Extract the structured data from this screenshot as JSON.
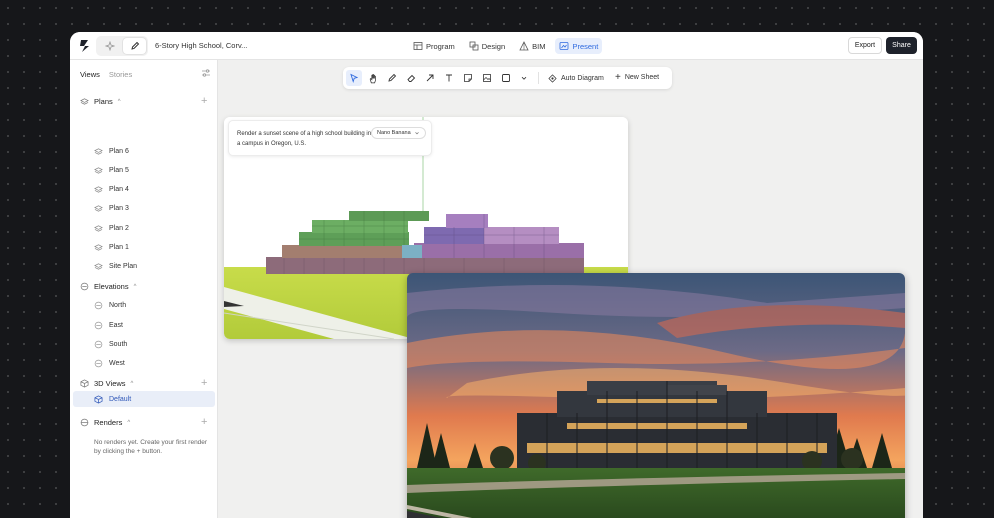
{
  "app": {
    "doc_title": "6-Story High School, Corv...",
    "nav": [
      "Program",
      "Design",
      "BIM",
      "Present"
    ],
    "active_nav": "Present",
    "export_label": "Export",
    "share_label": "Share",
    "accent": "#2f6adf"
  },
  "sidebar": {
    "tabs": [
      "Views",
      "Stories"
    ],
    "active_tab": "Views",
    "plans": {
      "label": "Plans",
      "items": [
        "Plan 6",
        "Plan 5",
        "Plan 4",
        "Plan 3",
        "Plan 2",
        "Plan 1",
        "Site Plan"
      ]
    },
    "elevations": {
      "label": "Elevations",
      "items": [
        "North",
        "East",
        "South",
        "West"
      ]
    },
    "views3d": {
      "label": "3D Views",
      "items": [
        "Default"
      ],
      "selected": "Default"
    },
    "renders": {
      "label": "Renders",
      "empty": "No renders yet. Create your first render by clicking the + button."
    }
  },
  "toolbar": {
    "tools": [
      "select-icon",
      "hand-icon",
      "pen-icon",
      "eraser-icon",
      "arrow-icon",
      "text-icon",
      "sticky-note-icon",
      "image-icon",
      "shape-icon",
      "chevron-down-icon"
    ],
    "auto_diagram": "Auto Diagram",
    "new_sheet": "New Sheet"
  },
  "canvas": {
    "prompt": "Render a sunset scene of a high school building in a campus in Oregon, U.S.",
    "model_chip": "Nano Banana"
  }
}
